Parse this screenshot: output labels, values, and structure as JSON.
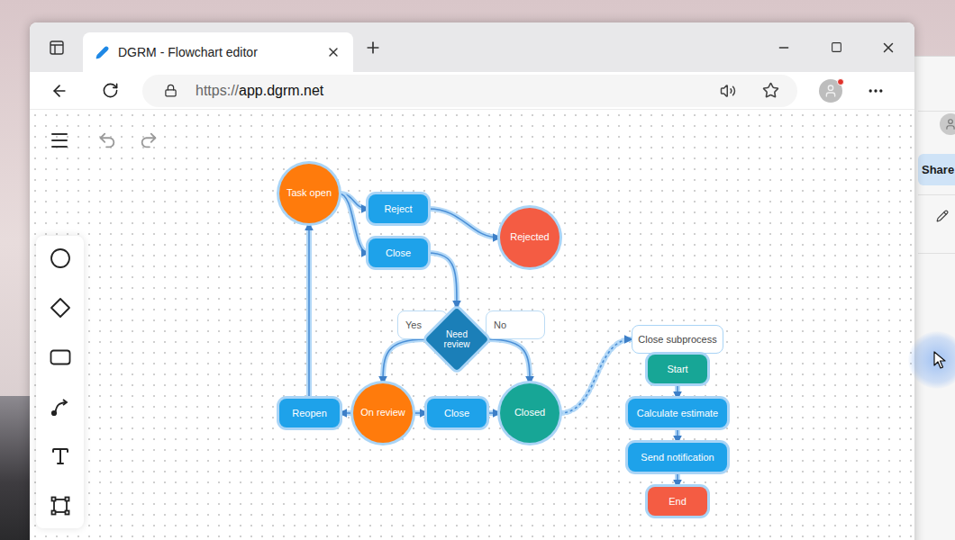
{
  "browser": {
    "tab_title": "DGRM - Flowchart editor",
    "url": {
      "scheme": "https://",
      "host": "app.dgrm.net"
    },
    "profile_notification": true
  },
  "diagram": {
    "nodes": [
      {
        "text": "Task open",
        "kind": "circle",
        "color": "#ff7b0c"
      },
      {
        "text": "Reject",
        "kind": "rect",
        "color": "#1ea2ea"
      },
      {
        "text": "Close",
        "kind": "rect",
        "color": "#1ea2ea"
      },
      {
        "text": "Rejected",
        "kind": "circle",
        "color": "#f45c43"
      },
      {
        "text": "Yes",
        "kind": "label",
        "color": "#ffffff"
      },
      {
        "text": "No",
        "kind": "label",
        "color": "#ffffff"
      },
      {
        "text": "Need review",
        "kind": "diamond",
        "color": "#1b7fb8"
      },
      {
        "text": "Reopen",
        "kind": "rect",
        "color": "#1ea2ea"
      },
      {
        "text": "On review",
        "kind": "circle",
        "color": "#ff7b0c"
      },
      {
        "text": "Close",
        "kind": "rect",
        "color": "#1ea2ea"
      },
      {
        "text": "Closed",
        "kind": "circle",
        "color": "#17a696"
      },
      {
        "text": "Close subprocess",
        "kind": "frame",
        "color": "#ffffff"
      },
      {
        "text": "Start",
        "kind": "rect",
        "color": "#17a696"
      },
      {
        "text": "Calculate estimate",
        "kind": "rect",
        "color": "#1ea2ea"
      },
      {
        "text": "Send notification",
        "kind": "rect",
        "color": "#1ea2ea"
      },
      {
        "text": "End",
        "kind": "rect",
        "color": "#f45c43"
      }
    ]
  },
  "side_window": {
    "button": "Share"
  }
}
